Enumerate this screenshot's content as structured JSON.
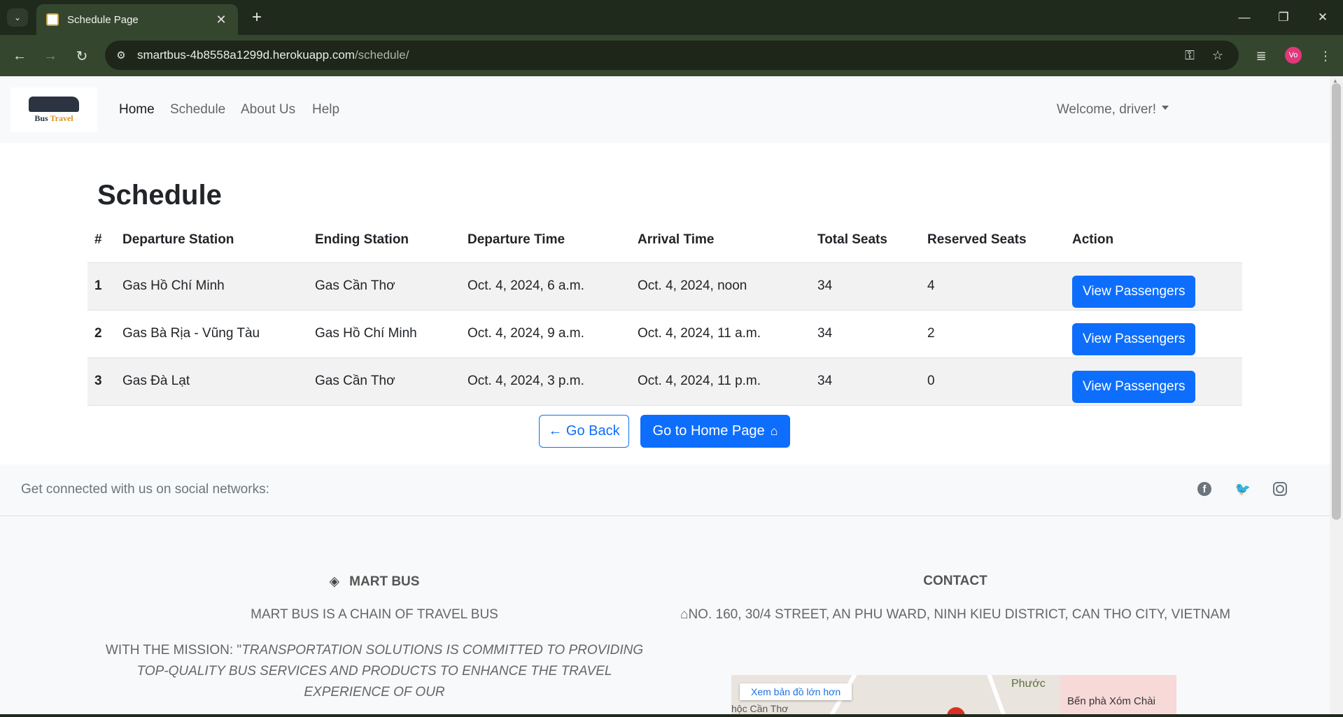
{
  "browser": {
    "tab_title": "Schedule Page",
    "url_host": "smartbus-4b8558a1299d.herokuapp.com",
    "url_path": "/schedule/",
    "profile_initials": "Vo"
  },
  "nav": {
    "links": [
      "Home",
      "Schedule",
      "About Us",
      "Help"
    ],
    "welcome": "Welcome, driver!",
    "logo_text_1": "Bus",
    "logo_text_2": "Travel"
  },
  "schedule": {
    "title": "Schedule",
    "headers": [
      "#",
      "Departure Station",
      "Ending Station",
      "Departure Time",
      "Arrival Time",
      "Total Seats",
      "Reserved Seats",
      "Action"
    ],
    "rows": [
      {
        "idx": "1",
        "departure": "Gas Hồ Chí Minh",
        "ending": "Gas Cần Thơ",
        "dep_time": "Oct. 4, 2024, 6 a.m.",
        "arr_time": "Oct. 4, 2024, noon",
        "total": "34",
        "reserved": "4",
        "action": "View Passengers"
      },
      {
        "idx": "2",
        "departure": "Gas Bà Rịa - Vũng Tàu",
        "ending": "Gas Hồ Chí Minh",
        "dep_time": "Oct. 4, 2024, 9 a.m.",
        "arr_time": "Oct. 4, 2024, 11 a.m.",
        "total": "34",
        "reserved": "2",
        "action": "View Passengers"
      },
      {
        "idx": "3",
        "departure": "Gas Đà Lạt",
        "ending": "Gas Cần Thơ",
        "dep_time": "Oct. 4, 2024, 3 p.m.",
        "arr_time": "Oct. 4, 2024, 11 p.m.",
        "total": "34",
        "reserved": "0",
        "action": "View Passengers"
      }
    ],
    "go_back": "← Go Back",
    "go_home": "Go to Home Page"
  },
  "footer": {
    "social_text": "Get connected with us on social networks:",
    "brand_title": "MART BUS",
    "brand_line": "MART BUS IS A CHAIN OF TRAVEL BUS",
    "mission_prefix": "WITH THE MISSION: \"",
    "mission_text": "TRANSPORTATION SOLUTIONS IS COMMITTED TO PROVIDING TOP-QUALITY BUS SERVICES AND PRODUCTS TO ENHANCE THE TRAVEL EXPERIENCE OF OUR",
    "contact_title": "CONTACT",
    "address": "NO. 160, 30/4 STREET, AN PHU WARD, NINH KIEU DISTRICT, CAN THO CITY, VIETNAM",
    "map_button": "Xem bản đồ lớn hơn",
    "map_label_1": "Phước",
    "map_label_2": "Bến phà Xóm Chài",
    "map_label_3": "hộc Cần Thơ"
  }
}
